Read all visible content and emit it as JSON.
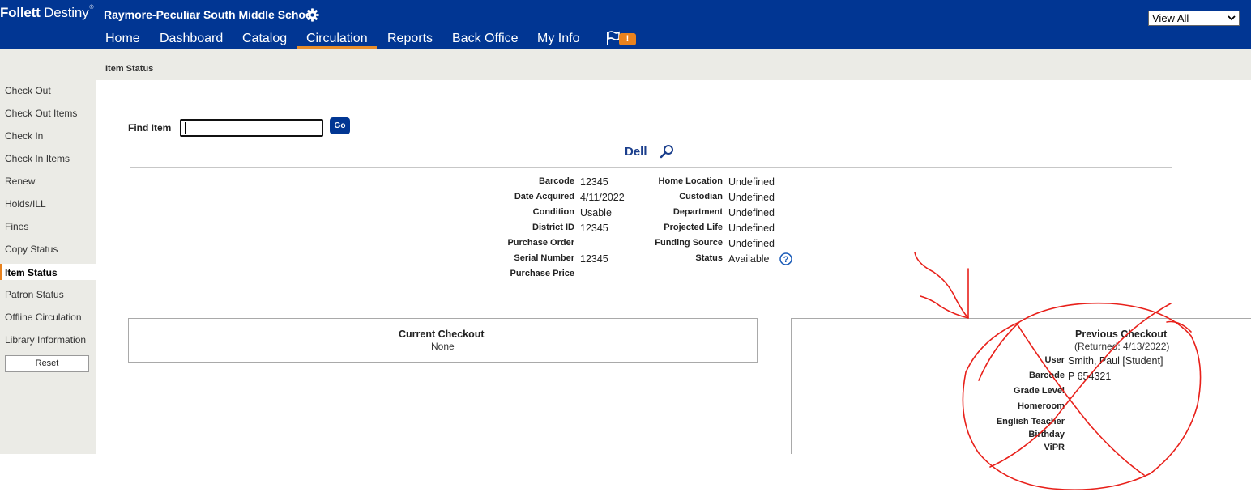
{
  "header": {
    "brand_bold": "Follett",
    "brand_light": " Destiny",
    "brand_mark": "®",
    "school": "Raymore-Peculiar South Middle School",
    "view_select": "View All",
    "nav": [
      "Home",
      "Dashboard",
      "Catalog",
      "Circulation",
      "Reports",
      "Back Office",
      "My Info"
    ],
    "active_nav": "Circulation",
    "alert_badge": "!",
    "colors": {
      "bar": "#013693",
      "accent": "#e88d2a"
    }
  },
  "breadcrumb": "Item Status",
  "sidebar": {
    "items": [
      "Check Out",
      "Check Out Items",
      "Check In",
      "Check In Items",
      "Renew",
      "Holds/ILL",
      "Fines",
      "Copy Status",
      "Item Status",
      "Patron Status",
      "Offline Circulation",
      "Library Information"
    ],
    "active": "Item Status",
    "reset": "Reset"
  },
  "find": {
    "label": "Find Item",
    "value": "",
    "go": "Go"
  },
  "item": {
    "title": "Dell",
    "left": [
      {
        "label": "Barcode",
        "value": "12345"
      },
      {
        "label": "Date Acquired",
        "value": "4/11/2022"
      },
      {
        "label": "Condition",
        "value": "Usable"
      },
      {
        "label": "District ID",
        "value": "12345"
      },
      {
        "label": "Purchase Order",
        "value": ""
      },
      {
        "label": "Serial Number",
        "value": "12345"
      },
      {
        "label": "Purchase Price",
        "value": ""
      }
    ],
    "right": [
      {
        "label": "Home Location",
        "value": "Undefined"
      },
      {
        "label": "Custodian",
        "value": "Undefined"
      },
      {
        "label": "Department",
        "value": "Undefined"
      },
      {
        "label": "Projected Life",
        "value": "Undefined"
      },
      {
        "label": "Funding Source",
        "value": "Undefined"
      },
      {
        "label": "Status",
        "value": "Available"
      }
    ]
  },
  "current_checkout": {
    "title": "Current Checkout",
    "value": "None"
  },
  "previous_checkout": {
    "title": "Previous Checkout",
    "returned": "(Returned: 4/13/2022)",
    "fields": [
      {
        "label": "User",
        "value": "Smith, Paul [Student]"
      },
      {
        "label": "Barcode",
        "value": "P 654321"
      },
      {
        "label": "Grade Level",
        "value": ""
      },
      {
        "label": "Homeroom",
        "value": ""
      },
      {
        "label": "English Teacher",
        "value": ""
      },
      {
        "label": "Birthday",
        "value": ""
      },
      {
        "label": "ViPR",
        "value": ""
      }
    ]
  },
  "annotation_color": "#e8201a"
}
